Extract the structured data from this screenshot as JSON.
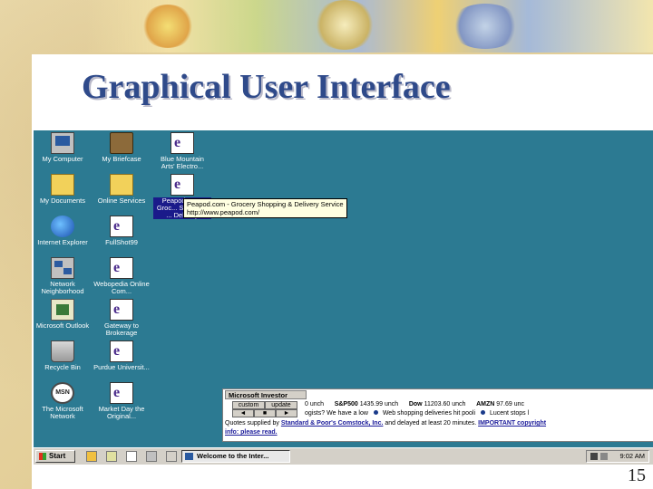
{
  "slide": {
    "title": "Graphical User Interface",
    "number": "15"
  },
  "desktop": {
    "icons": [
      {
        "label": "My Computer",
        "icon": "computer-icon"
      },
      {
        "label": "My Briefcase",
        "icon": "briefcase-icon"
      },
      {
        "label": "Blue Mountain Arts' Electro...",
        "icon": "internet-shortcut-icon"
      },
      {
        "label": "My Documents",
        "icon": "folder-icon"
      },
      {
        "label": "Online Services",
        "icon": "folder-icon"
      },
      {
        "label": "Peapod, Int... Groc... Shopping ... Delivery",
        "icon": "internet-shortcut-icon"
      },
      {
        "label": "Internet Explorer",
        "icon": "internet-explorer-icon"
      },
      {
        "label": "FullShot99",
        "icon": "application-icon"
      },
      {
        "label": "Network Neighborhood",
        "icon": "network-icon"
      },
      {
        "label": "Webopedia Online Com...",
        "icon": "internet-shortcut-icon"
      },
      {
        "label": "Microsoft Outlook",
        "icon": "outlook-icon"
      },
      {
        "label": "Gateway to Brokerage",
        "icon": "internet-shortcut-icon"
      },
      {
        "label": "Recycle Bin",
        "icon": "recycle-bin-icon"
      },
      {
        "label": "Purdue Universit...",
        "icon": "internet-shortcut-icon"
      },
      {
        "label": "The Microsoft Network",
        "icon": "msn-icon"
      },
      {
        "label": "Market Day the Original...",
        "icon": "internet-shortcut-icon"
      }
    ],
    "tooltip": {
      "line1": "Peapod.com - Grocery Shopping & Delivery Service",
      "line2": "http://www.peapod.com/"
    }
  },
  "ticker": {
    "title": "Microsoft Investor",
    "custom_label": "custom",
    "update_label": "update",
    "prev_label": "◄",
    "stop_label": "■",
    "next_label": "►",
    "row1": [
      {
        "text": "0 unch"
      },
      {
        "symbol": "S&P500",
        "text": "1435.99 unch"
      },
      {
        "symbol": "Dow",
        "text": "11203.60 unch"
      },
      {
        "symbol": "AMZN",
        "text": "97.69 unc"
      }
    ],
    "row2": [
      {
        "text": "ogists? We have a low"
      },
      {
        "text": "Web shopping deliveries hit pooli"
      },
      {
        "text": "Lucent stops l"
      }
    ],
    "footer_prefix": "Quotes supplied by",
    "footer_source": "Standard & Poor's Comstock, Inc.",
    "footer_middle": "and delayed at least 20 minutes.",
    "footer_link": "IMPORTANT copyright",
    "footer_line2": "info: please read."
  },
  "taskbar": {
    "start_label": "Start",
    "task_label": "Welcome to the Inter...",
    "clock": "9:02 AM"
  }
}
